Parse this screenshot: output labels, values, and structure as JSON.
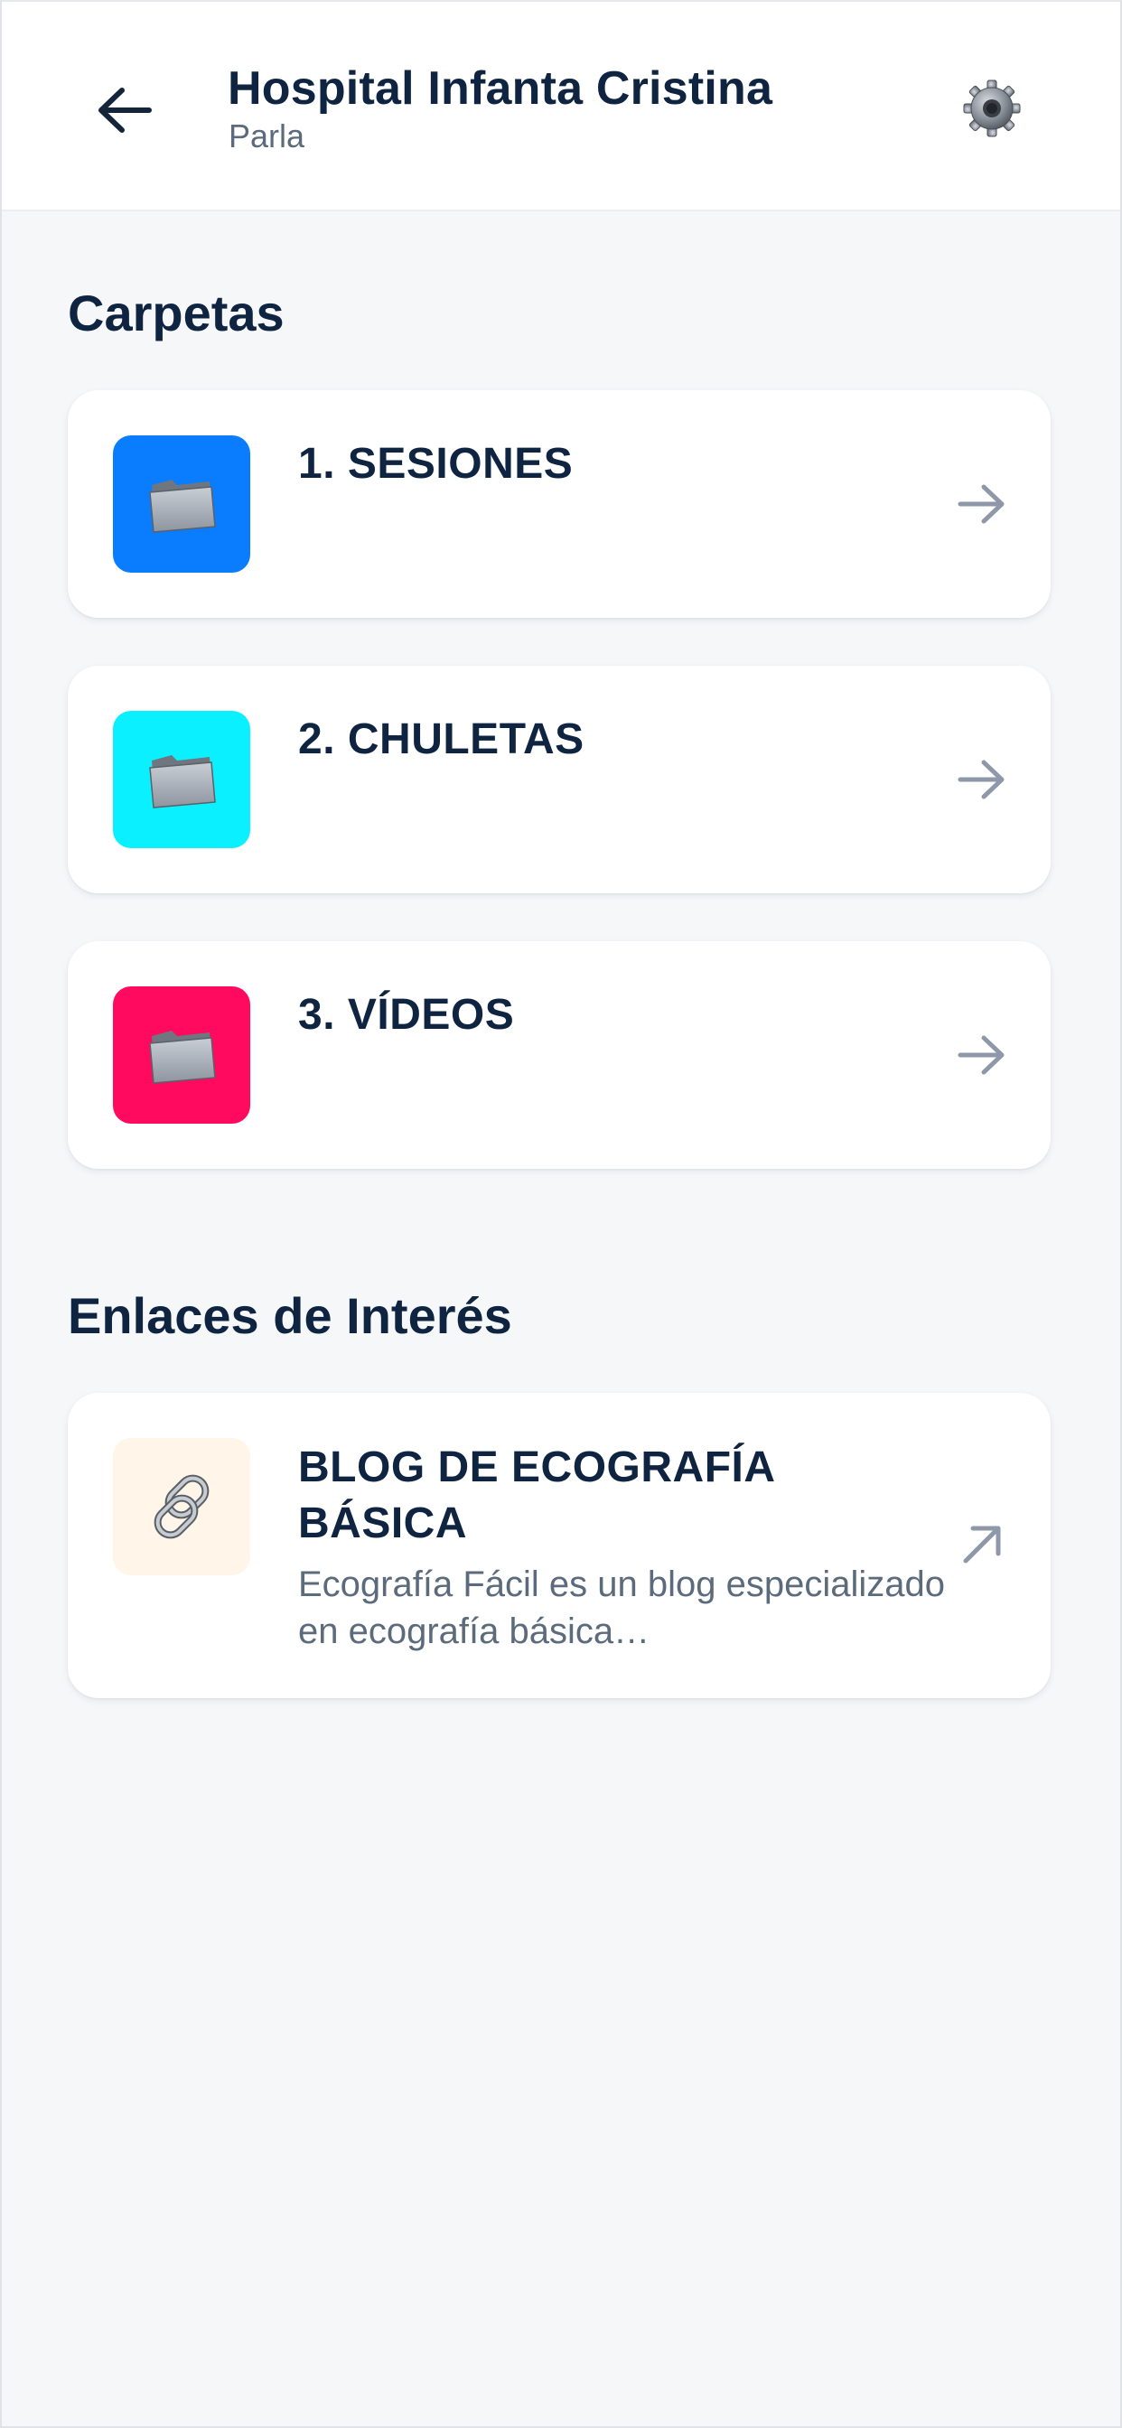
{
  "header": {
    "title": "Hospital Infanta Cristina",
    "subtitle": "Parla",
    "back_icon": "arrow-left-icon",
    "settings_icon": "gear-icon"
  },
  "folders_section": {
    "title": "Carpetas",
    "items": [
      {
        "label": "1. SESIONES",
        "icon": "folder-icon",
        "color": "#0a7dff"
      },
      {
        "label": "2. CHULETAS",
        "icon": "folder-icon",
        "color": "#0af0ff"
      },
      {
        "label": "3. VÍDEOS",
        "icon": "folder-icon",
        "color": "#ff0a5e"
      }
    ]
  },
  "links_section": {
    "title": "Enlaces de Interés",
    "items": [
      {
        "title": "BLOG DE ECOGRAFÍA BÁSICA",
        "description": "Ecografía Fácil es un blog especializado en ecografía básica…",
        "icon": "link-icon",
        "color": "#fff5e8"
      }
    ]
  },
  "colors": {
    "background": "#f6f7f9",
    "text_primary": "#0e2440",
    "text_secondary": "#5c6b7c",
    "arrow": "#8e98a8"
  }
}
